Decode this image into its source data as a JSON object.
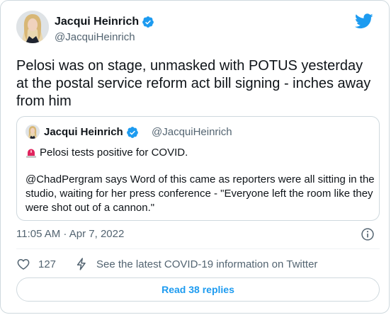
{
  "colors": {
    "accent": "#1d9bf0",
    "text": "#0f1419",
    "muted": "#536471",
    "border": "#cfd9de",
    "alert_red": "#e0245e"
  },
  "tweet": {
    "author_name": "Jacqui Heinrich",
    "author_handle": "@JacquiHeinrich",
    "verified_icon": "verified-badge-icon",
    "text": "Pelosi was on stage, unmasked with POTUS yesterday at the postal service reform act bill signing - inches away from him",
    "timestamp": "11:05 AM · Apr 7, 2022",
    "like_count": "127",
    "covid_info": "See the latest COVID-19 information on Twitter",
    "read_replies": "Read 38 replies"
  },
  "quoted": {
    "author_name": "Jacqui Heinrich",
    "author_handle": "@JacquiHeinrich",
    "line1": "Pelosi tests positive for COVID.",
    "line1_icon": "siren-icon",
    "body": "@ChadPergram says Word of this came as reporters were all sitting in the studio, waiting for her press conference - \"Everyone left the room like they were shot out of a cannon.\""
  },
  "icons": {
    "brand": "twitter-bird-icon",
    "info": "info-icon",
    "like": "heart-icon",
    "covid": "lightning-icon"
  }
}
